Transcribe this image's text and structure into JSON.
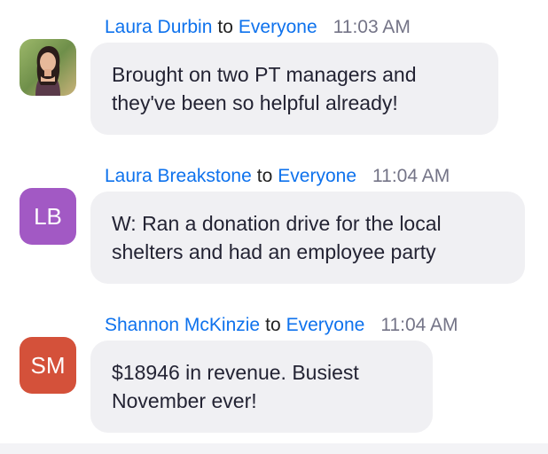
{
  "messages": [
    {
      "sender": "Laura Durbin",
      "to_word": "to",
      "recipient": "Everyone",
      "time": "11:03 AM",
      "avatar": {
        "type": "photo",
        "initials": ""
      },
      "text_lines": [
        "Brought on two PT managers and",
        "they've been so helpful already!"
      ]
    },
    {
      "sender": "Laura Breakstone",
      "to_word": "to",
      "recipient": "Everyone",
      "time": "11:04 AM",
      "avatar": {
        "type": "initials",
        "initials": "LB",
        "color": "#a259c4"
      },
      "text_lines": [
        "W: Ran a donation drive for the local",
        "shelters and had an employee party"
      ]
    },
    {
      "sender": "Shannon McKinzie",
      "to_word": "to",
      "recipient": "Everyone",
      "time": "11:04 AM",
      "avatar": {
        "type": "initials",
        "initials": "SM",
        "color": "#d4513a"
      },
      "text_lines": [
        "$18946 in revenue. Busiest",
        "November ever!"
      ]
    }
  ],
  "colors": {
    "link_blue": "#0e72ed",
    "bubble_bg": "#f0f0f3",
    "time_gray": "#747487"
  }
}
